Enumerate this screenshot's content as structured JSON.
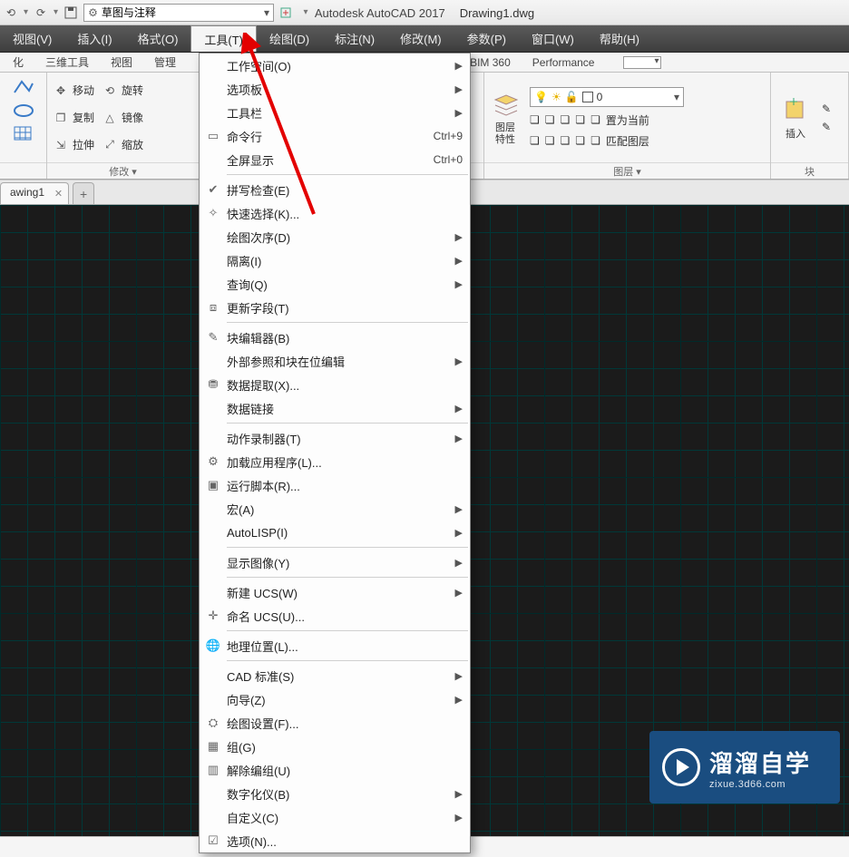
{
  "title": {
    "app": "Autodesk AutoCAD 2017",
    "doc": "Drawing1.dwg"
  },
  "workspace_combo": "草图与注释",
  "menubar": [
    {
      "label": "视图(V)"
    },
    {
      "label": "插入(I)"
    },
    {
      "label": "格式(O)"
    },
    {
      "label": "工具(T)",
      "active": true
    },
    {
      "label": "绘图(D)"
    },
    {
      "label": "标注(N)"
    },
    {
      "label": "修改(M)"
    },
    {
      "label": "参数(P)"
    },
    {
      "label": "窗口(W)"
    },
    {
      "label": "帮助(H)"
    }
  ],
  "ribbon_tabs": [
    {
      "label": "化"
    },
    {
      "label": "三维工具"
    },
    {
      "label": "视图"
    },
    {
      "label": "管理"
    },
    {
      "label": "BIM 360"
    },
    {
      "label": "Performance"
    }
  ],
  "ribbon": {
    "modify": {
      "rows": [
        {
          "icon": "move-icon",
          "label": "移动",
          "icon2": "rotate-icon",
          "label2": "旋转"
        },
        {
          "icon": "copy-icon",
          "label": "复制",
          "icon2": "mirror-icon",
          "label2": "镜像"
        },
        {
          "icon": "stretch-icon",
          "label": "拉伸",
          "icon2": "scale-icon",
          "label2": "缩放"
        }
      ],
      "panel_label": "修改 ▾"
    },
    "layers": {
      "panel_label": "图层 ▾",
      "big_label": "图层\n特性",
      "combo_value": "0",
      "btn_setcurrent": "置为当前",
      "btn_matchlayer": "匹配图层"
    },
    "insert": {
      "panel_label": "插入",
      "side_label": "块"
    }
  },
  "doc_tab": {
    "name": "awing1"
  },
  "menu": [
    {
      "icon": "",
      "label": "工作空间(O)",
      "sub": true
    },
    {
      "icon": "",
      "label": "选项板",
      "sub": true
    },
    {
      "icon": "",
      "label": "工具栏",
      "sub": true
    },
    {
      "icon": "cmdline-icon",
      "label": "命令行",
      "shortcut": "Ctrl+9"
    },
    {
      "icon": "",
      "label": "全屏显示",
      "shortcut": "Ctrl+0"
    },
    {
      "sep": true
    },
    {
      "icon": "spellcheck-icon",
      "label": "拼写检查(E)"
    },
    {
      "icon": "quickselect-icon",
      "label": "快速选择(K)..."
    },
    {
      "icon": "",
      "label": "绘图次序(D)",
      "sub": true
    },
    {
      "icon": "",
      "label": "隔离(I)",
      "sub": true
    },
    {
      "icon": "",
      "label": "查询(Q)",
      "sub": true
    },
    {
      "icon": "field-icon",
      "label": "更新字段(T)"
    },
    {
      "sep": true
    },
    {
      "icon": "blockedit-icon",
      "label": "块编辑器(B)"
    },
    {
      "icon": "",
      "label": "外部参照和块在位编辑",
      "sub": true
    },
    {
      "icon": "dataextract-icon",
      "label": "数据提取(X)..."
    },
    {
      "icon": "",
      "label": "数据链接",
      "sub": true
    },
    {
      "sep": true
    },
    {
      "icon": "",
      "label": "动作录制器(T)",
      "sub": true
    },
    {
      "icon": "loadapp-icon",
      "label": "加载应用程序(L)..."
    },
    {
      "icon": "script-icon",
      "label": "运行脚本(R)..."
    },
    {
      "icon": "",
      "label": "宏(A)",
      "sub": true
    },
    {
      "icon": "",
      "label": "AutoLISP(I)",
      "sub": true
    },
    {
      "sep": true
    },
    {
      "icon": "",
      "label": "显示图像(Y)",
      "sub": true
    },
    {
      "sep": true
    },
    {
      "icon": "",
      "label": "新建 UCS(W)",
      "sub": true
    },
    {
      "icon": "ucs-icon",
      "label": "命名 UCS(U)..."
    },
    {
      "sep": true
    },
    {
      "icon": "geo-icon",
      "label": "地理位置(L)..."
    },
    {
      "sep": true
    },
    {
      "icon": "",
      "label": "CAD 标准(S)",
      "sub": true
    },
    {
      "icon": "",
      "label": "向导(Z)",
      "sub": true
    },
    {
      "icon": "draftset-icon",
      "label": "绘图设置(F)..."
    },
    {
      "icon": "group-icon",
      "label": "组(G)"
    },
    {
      "icon": "ungroup-icon",
      "label": "解除编组(U)"
    },
    {
      "icon": "",
      "label": "数字化仪(B)",
      "sub": true
    },
    {
      "icon": "",
      "label": "自定义(C)",
      "sub": true
    },
    {
      "icon": "options-icon",
      "label": "选项(N)..."
    }
  ],
  "watermark": {
    "big": "溜溜自学",
    "small": "zixue.3d66.com"
  },
  "statusbar": ""
}
